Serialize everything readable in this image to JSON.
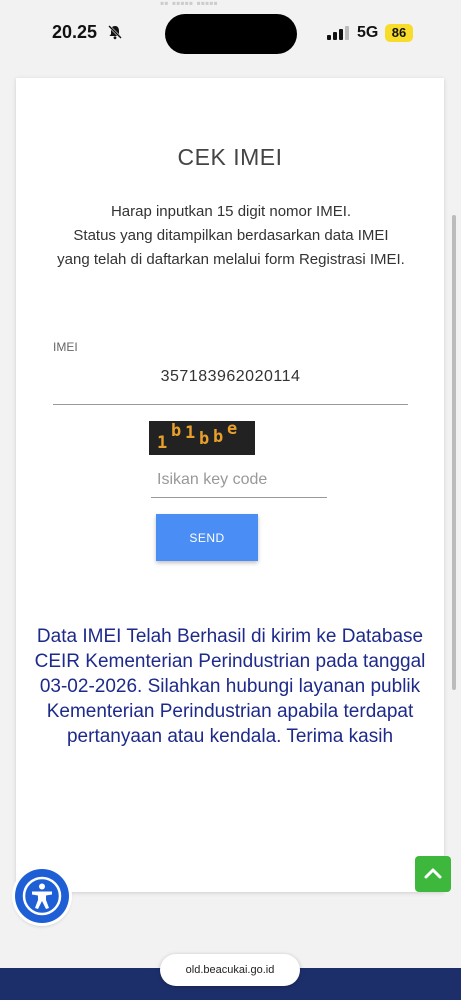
{
  "status_bar": {
    "time": "20.25",
    "network": "5G",
    "battery": "86"
  },
  "page": {
    "title": "CEK IMEI",
    "instructions": "Harap inputkan 15 digit nomor IMEI.\nStatus yang ditampilkan berdasarkan data IMEI yang telah di daftarkan melalui form Registrasi IMEI.",
    "imei_label": "IMEI",
    "imei_value": "357183962020114",
    "captcha_chars": [
      "1",
      "b",
      "1",
      "b",
      "b",
      "e"
    ],
    "key_placeholder": "Isikan key code",
    "send_label": "SEND",
    "result_message": "Data IMEI Telah Berhasil di kirim ke Database CEIR Kementerian Perindustrian pada tanggal 03-02-2026. Silahkan hubungi layanan publik Kementerian Perindustrian apabila terdapat pertanyaan atau kendala. Terima kasih"
  },
  "browser": {
    "url": "old.beacukai.go.id"
  },
  "icons": {
    "bell": "bell-muted-icon",
    "signal": "signal-icon",
    "accessibility": "accessibility-icon",
    "back_to_top": "chevron-up-icon"
  },
  "colors": {
    "send_button": "#4a8ef5",
    "result_text": "#1e2a8a",
    "accessibility": "#1f5fd6",
    "back_to_top": "#3db83d",
    "footer": "#1d2f6b",
    "battery": "#f7dc2a"
  }
}
